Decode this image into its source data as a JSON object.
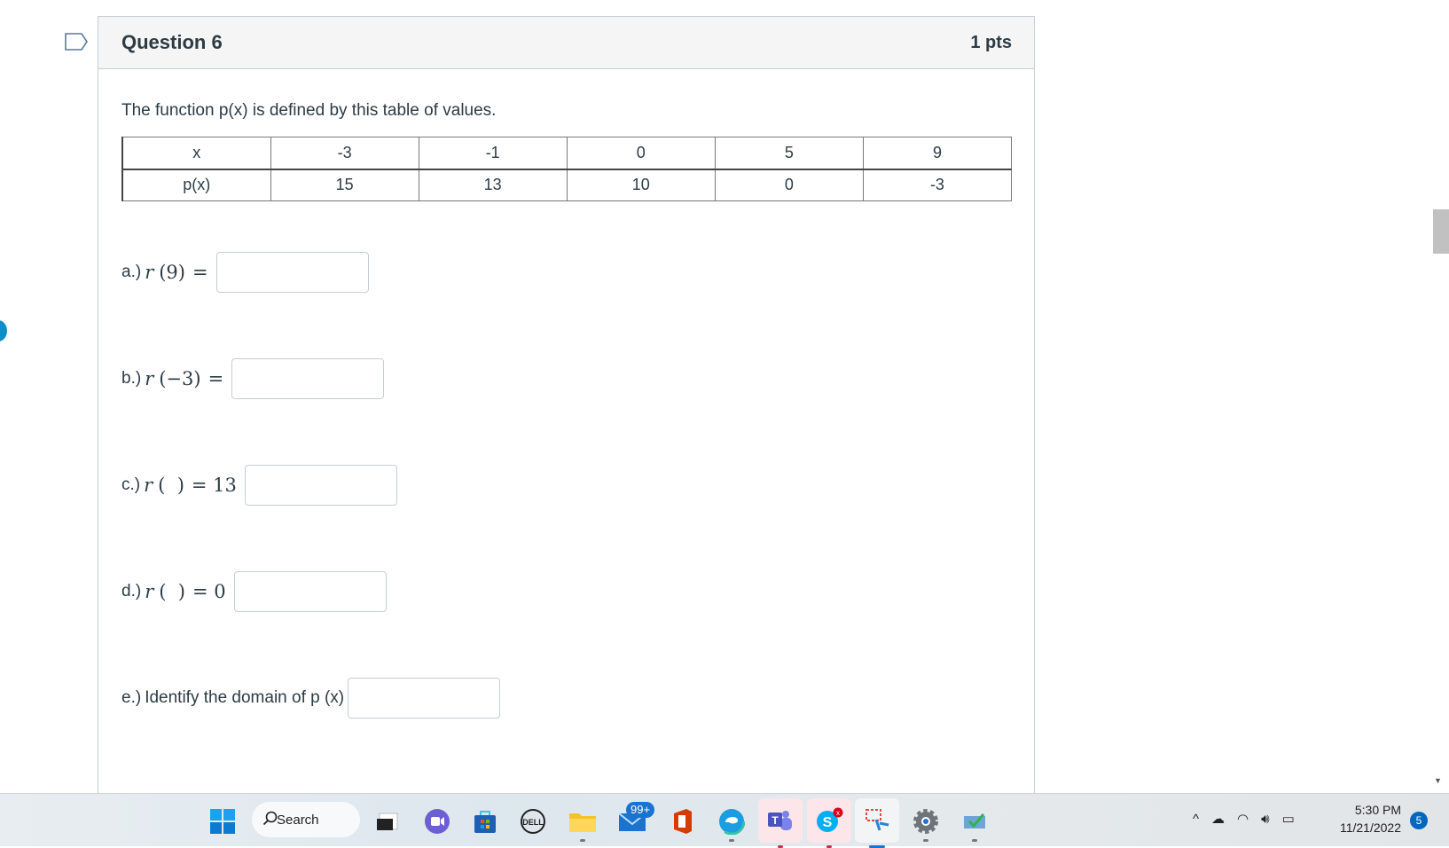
{
  "question": {
    "title": "Question 6",
    "points": "1 pts",
    "intro": "The function p(x) is defined by this table of values.",
    "table": {
      "rows": [
        {
          "header": "x",
          "cells": [
            "-3",
            "-1",
            "0",
            "5",
            "9"
          ]
        },
        {
          "header": "p(x)",
          "cells": [
            "15",
            "13",
            "10",
            "0",
            "-3"
          ]
        }
      ]
    },
    "parts": [
      {
        "label": "a.)",
        "func": "r",
        "arg": "(9)",
        "rhs": "=",
        "value": ""
      },
      {
        "label": "b.)",
        "func": "r",
        "arg": "(−3)",
        "rhs": "=",
        "value": ""
      },
      {
        "label": "c.)",
        "func": "r",
        "arg": "(  )",
        "rhs": "= 13",
        "value": ""
      },
      {
        "label": "d.)",
        "func": "r",
        "arg": "(  )",
        "rhs": "= 0",
        "value": ""
      },
      {
        "label": "e.)",
        "text": "Identify the domain of p (x)",
        "value": ""
      }
    ]
  },
  "taskbar": {
    "search_label": "Search",
    "mail_badge": "99+",
    "clock_time": "5:30 PM",
    "clock_date": "11/21/2022",
    "notification_count": "5"
  }
}
